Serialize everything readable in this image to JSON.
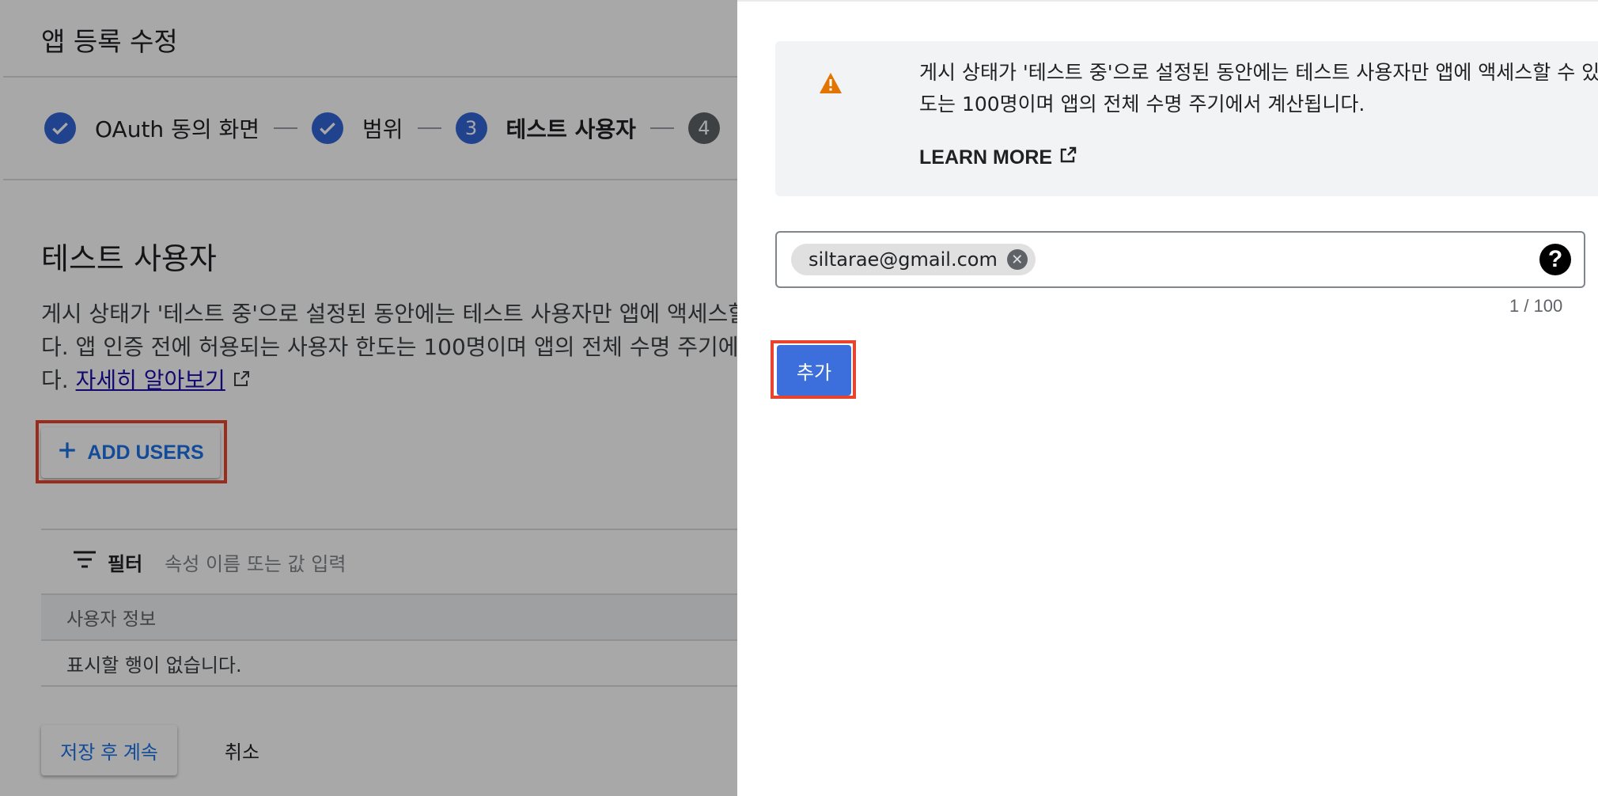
{
  "page": {
    "title": "앱 등록 수정",
    "steps": [
      {
        "label": "OAuth 동의 화면",
        "state": "done"
      },
      {
        "label": "범위",
        "state": "done"
      },
      {
        "number": "3",
        "label": "테스트 사용자",
        "state": "current"
      },
      {
        "number": "4",
        "state": "pending"
      }
    ],
    "section_title": "테스트 사용자",
    "description_lines": [
      "게시 상태가 '테스트 중'으로 설정된 동안에는 테스트 사용자만 앱에 액세스할",
      "다. 앱 인증 전에 허용되는 사용자 한도는 100명이며 앱의 전체 수명 주기에서",
      "다."
    ],
    "learn_more_link": "자세히 알아보기",
    "add_users_label": "ADD USERS",
    "filter_label": "필터",
    "filter_placeholder": "속성 이름 또는 값 입력",
    "table_header": "사용자 정보",
    "table_empty": "표시할 행이 없습니다.",
    "save_label": "저장 후 계속",
    "cancel_label": "취소"
  },
  "panel": {
    "notice_lines": [
      "게시 상태가 '테스트 중'으로 설정된 동안에는 테스트 사용자만 앱에 액세스할 수 있습니다.",
      "도는 100명이며 앱의 전체 수명 주기에서 계산됩니다."
    ],
    "learn_more": "LEARN MORE",
    "chip_email": "siltarae@gmail.com",
    "help_symbol": "?",
    "counter": "1 / 100",
    "add_label": "추가"
  },
  "colors": {
    "accent": "#3367d6",
    "add_button": "#3c6fdb",
    "highlight": "#e8432c",
    "warning": "#e37400"
  },
  "icons": [
    "check-icon",
    "warning-icon",
    "external-link-icon",
    "plus-icon",
    "filter-icon",
    "clear-chip-icon",
    "help-icon"
  ]
}
